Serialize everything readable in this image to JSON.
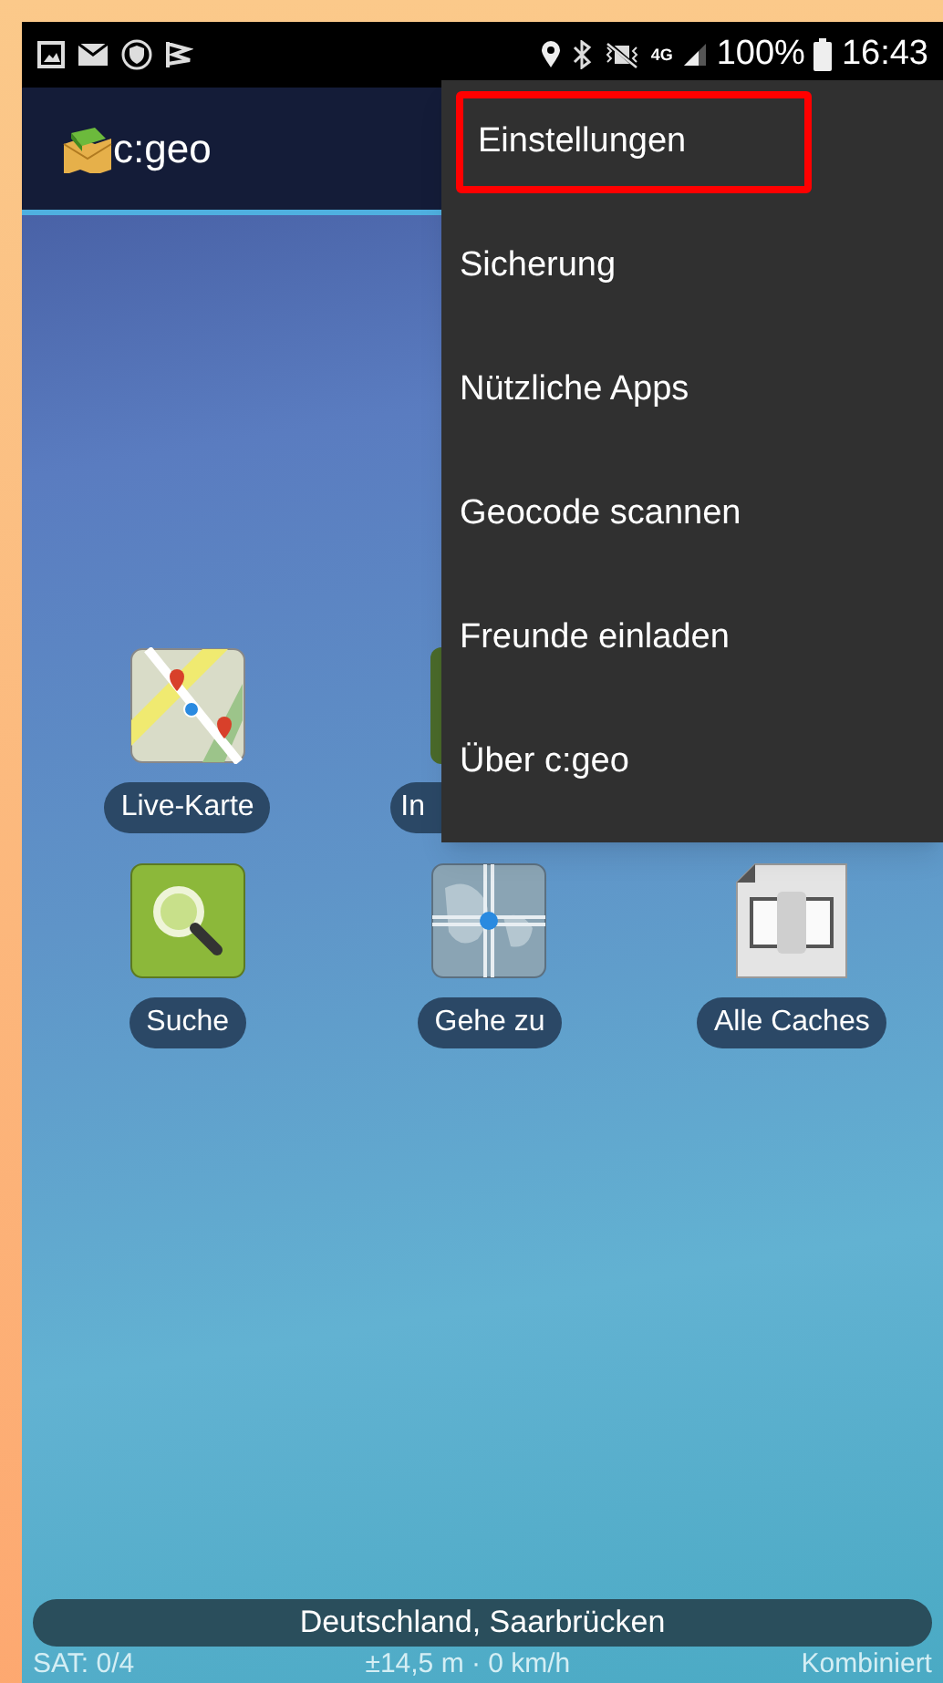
{
  "status_bar": {
    "network": "4G",
    "battery": "100%",
    "time": "16:43"
  },
  "app_bar": {
    "title": "c:geo"
  },
  "menu": {
    "items": [
      {
        "label": "Einstellungen",
        "highlighted": true
      },
      {
        "label": "Sicherung",
        "highlighted": false
      },
      {
        "label": "Nützliche Apps",
        "highlighted": false
      },
      {
        "label": "Geocode scannen",
        "highlighted": false
      },
      {
        "label": "Freunde einladen",
        "highlighted": false
      },
      {
        "label": "Über c:geo",
        "highlighted": false
      }
    ]
  },
  "tile_rows": [
    [
      {
        "label": "Live-Karte",
        "kind": "map"
      },
      {
        "label": "In",
        "kind": "covered"
      }
    ],
    [
      {
        "label": "Suche",
        "kind": "search"
      },
      {
        "label": "Gehe zu",
        "kind": "globe"
      },
      {
        "label": "Alle Caches",
        "kind": "caches"
      }
    ]
  ],
  "location": {
    "address": "Deutschland, Saarbrücken",
    "satellites": "SAT: 0/4",
    "accuracy": "±14,5 m · 0 km/h",
    "provider": "Kombiniert"
  }
}
